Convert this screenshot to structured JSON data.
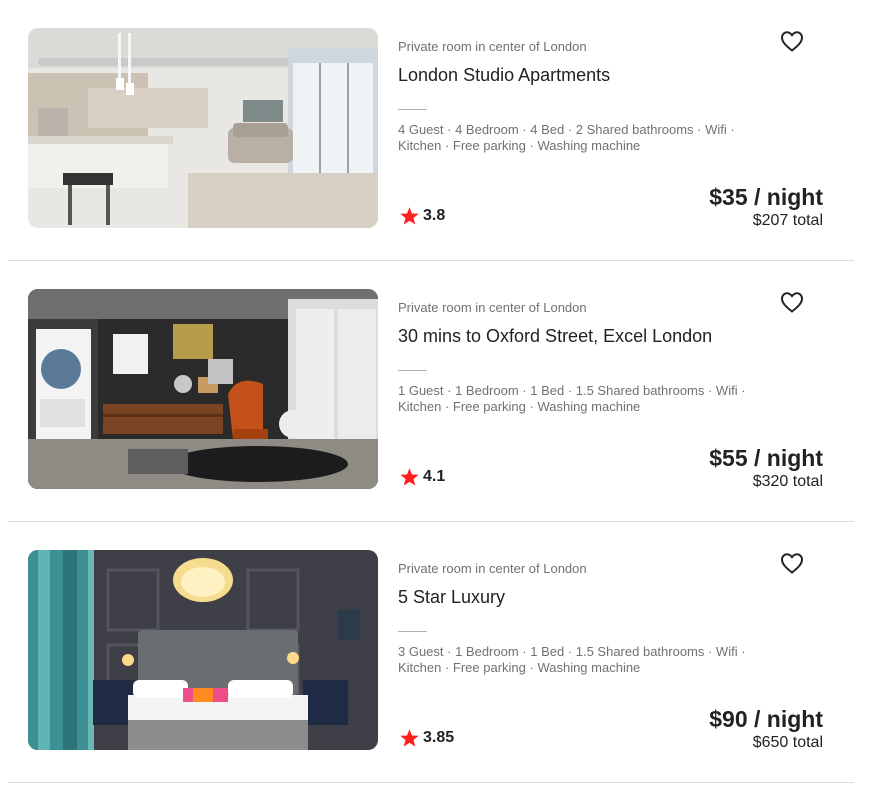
{
  "listings": [
    {
      "subtitle": "Private room in center of London",
      "title": "London Studio Apartments",
      "amenities_line1": "4 Guest · 4 Bedroom · 4 Bed · 2 Shared bathrooms · Wifi ·",
      "amenities_line2": "Kitchen · Free parking · Washing machine",
      "rating": "3.8",
      "price": "$35 / night",
      "total": "$207 total",
      "photo_subject": "modern studio apartment with kitchen island and grey sofa"
    },
    {
      "subtitle": "Private room in center of London",
      "title": "30 mins to Oxford Street, Excel London",
      "amenities_line1": "1 Guest · 1 Bedroom · 1 Bed · 1.5 Shared bathrooms · Wifi ·",
      "amenities_line2": "Kitchen · Free parking · Washing machine",
      "rating": "4.1",
      "price": "$55 / night",
      "total": "$320 total",
      "photo_subject": "dark living room with orange armchair and wooden sideboard"
    },
    {
      "subtitle": "Private room in center of London",
      "title": "5 Star Luxury",
      "amenities_line1": "3 Guest · 1 Bedroom · 1 Bed · 1.5 Shared bathrooms · Wifi ·",
      "amenities_line2": "Kitchen · Free parking · Washing machine",
      "rating": "3.85",
      "price": "$90 / night",
      "total": "$650 total",
      "photo_subject": "bedroom with feather pendant lamp and teal curtains"
    }
  ],
  "colors": {
    "star": "#ff1f1f",
    "text_primary": "#222222",
    "text_secondary": "#717171",
    "divider": "#dddddd"
  },
  "icons": {
    "favorite": "heart-outline-icon",
    "rating": "star-icon"
  }
}
